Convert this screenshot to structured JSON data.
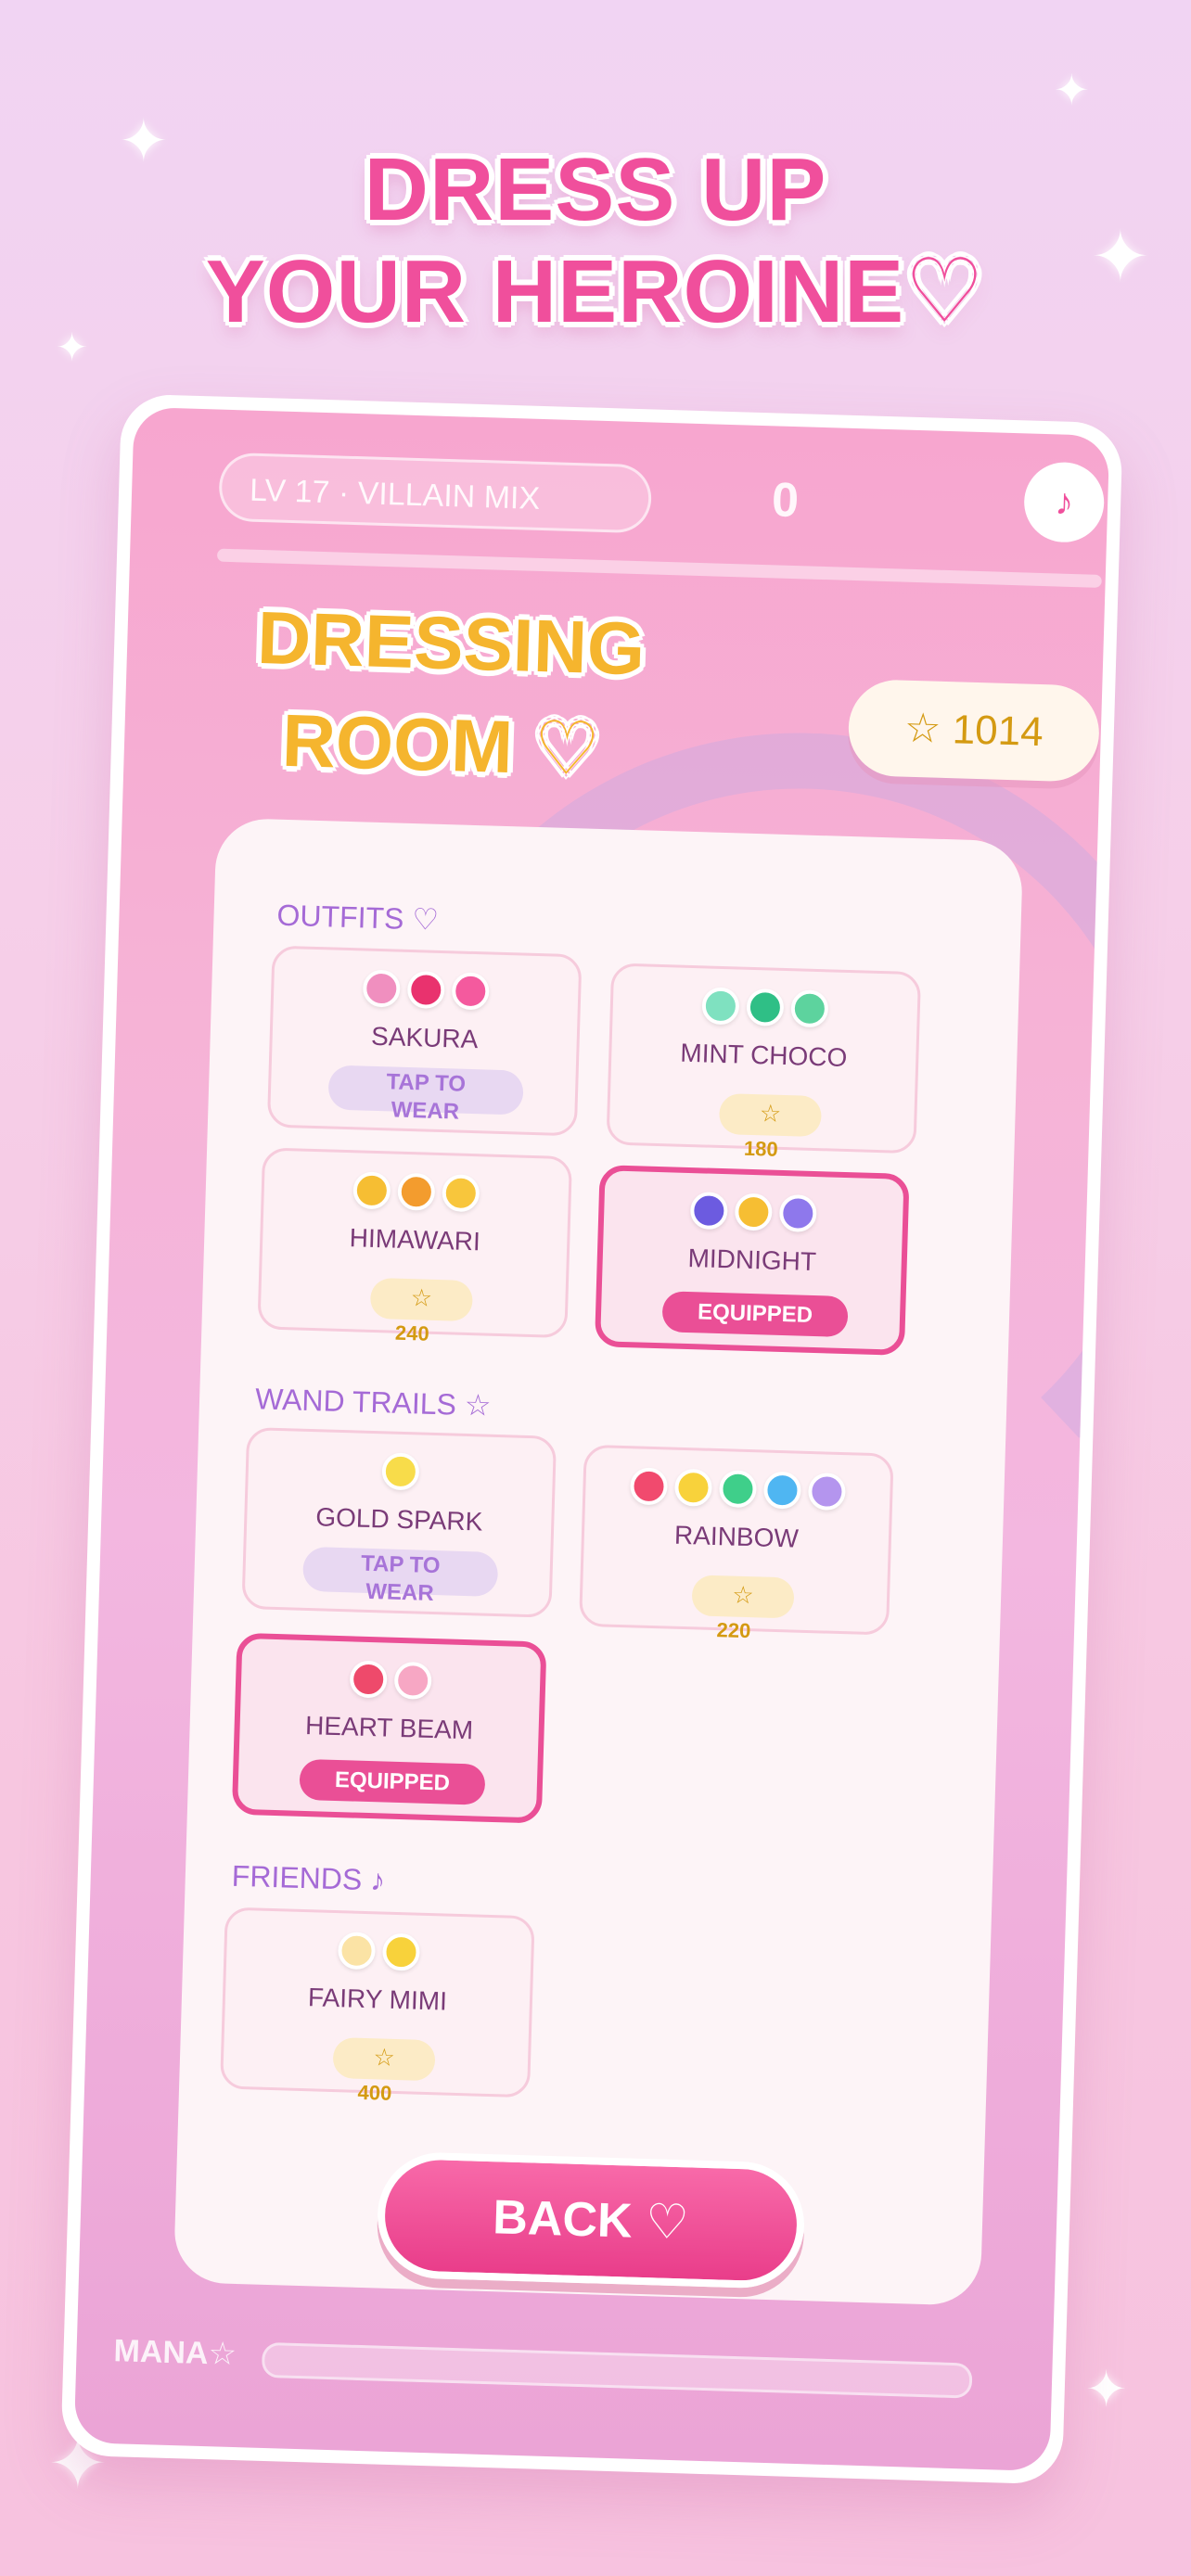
{
  "headline": {
    "line1": "DRESS UP",
    "line2": "YOUR HEROINE♡"
  },
  "hud": {
    "level_text": "LV 17 · VILLAIN MIX",
    "counter": "0",
    "music_icon": "♪",
    "stars": "☆ 1014"
  },
  "room_title": {
    "line1": "DRESSING",
    "line2": "ROOM ♡"
  },
  "sections": {
    "outfits": "OUTFITS ♡",
    "wand_trails": "WAND TRAILS ☆",
    "friends": "FRIENDS ♪"
  },
  "outfits": [
    {
      "name": "SAKURA",
      "dots": [
        "#f08fbf",
        "#e9326e",
        "#f45a9e"
      ],
      "tap_line1": "TAP TO",
      "tap_line2": "WEAR"
    },
    {
      "name": "MINT CHOCO",
      "dots": [
        "#7fe1c0",
        "#2fbf86",
        "#5dd39e"
      ],
      "price_icon": "☆",
      "price": "180"
    },
    {
      "name": "HIMAWARI",
      "dots": [
        "#f6be33",
        "#f39c2e",
        "#f8c63c"
      ],
      "price_icon": "☆",
      "price": "240"
    },
    {
      "name": "MIDNIGHT",
      "dots": [
        "#6c5be0",
        "#f6be33",
        "#8e78ec"
      ],
      "equipped": "EQUIPPED"
    }
  ],
  "wand_trails": [
    {
      "name": "GOLD SPARK",
      "dots": [
        "#f8dc4a"
      ],
      "tap_line1": "TAP TO",
      "tap_line2": "WEAR"
    },
    {
      "name": "RAINBOW",
      "dots": [
        "#f14a6e",
        "#f8d23b",
        "#3fcf8a",
        "#4fb6f2",
        "#b495ee"
      ],
      "price_icon": "☆",
      "price": "220"
    },
    {
      "name": "HEART BEAM",
      "dots": [
        "#ee4a6b",
        "#f7a7c4"
      ],
      "equipped": "EQUIPPED"
    }
  ],
  "friends": [
    {
      "name": "FAIRY MIMI",
      "dots": [
        "#fbe3a5",
        "#f8d23b"
      ],
      "price_icon": "☆",
      "price": "400"
    }
  ],
  "back_button": "BACK ♡",
  "footer_logo": "MANA☆",
  "colors": {
    "accent_pink": "#ea4f96",
    "gold": "#d49a12",
    "lavender": "#a56ad6"
  }
}
